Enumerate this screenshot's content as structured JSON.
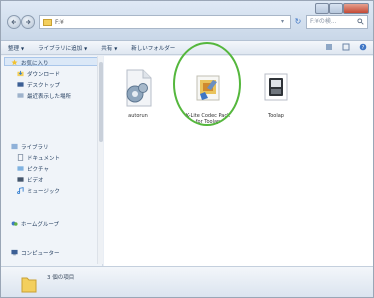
{
  "address": {
    "path": "F:¥",
    "search_placeholder": "F:¥の検..."
  },
  "commands": {
    "organize": "整理",
    "include_library": "ライブラリに追加",
    "share": "共有",
    "new_folder": "新しいフォルダー"
  },
  "sidebar": {
    "favorites": "お気に入り",
    "downloads": "ダウンロード",
    "desktop": "デスクトップ",
    "recent": "最近表示した場所",
    "libraries": "ライブラリ",
    "documents": "ドキュメント",
    "pictures": "ピクチャ",
    "videos": "ビデオ",
    "music": "ミュージック",
    "homegroup": "ホームグループ",
    "computer": "コンピューター"
  },
  "files": [
    {
      "label": "autorun"
    },
    {
      "label": "K-Lite Codec Pack for Toolap"
    },
    {
      "label": "Toolap"
    }
  ],
  "status": {
    "count": "3 個の項目"
  },
  "colors": {
    "highlight": "#55b73d",
    "folder": "#f3cf5d"
  }
}
